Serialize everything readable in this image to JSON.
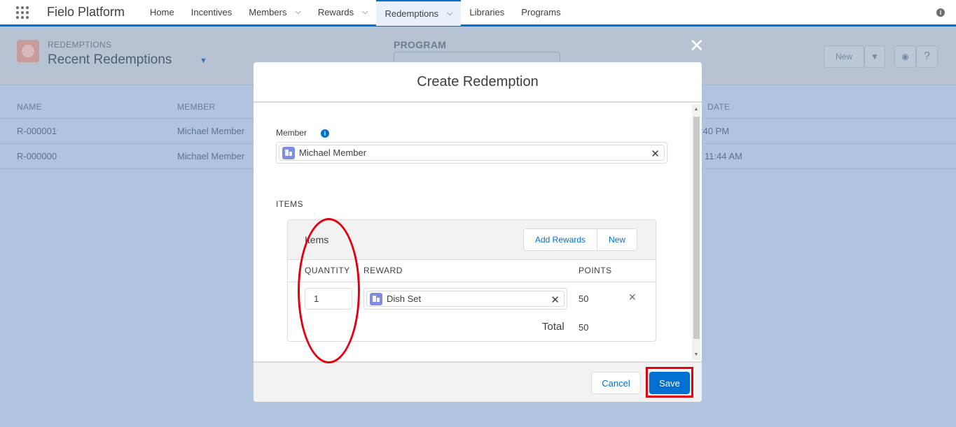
{
  "app": {
    "name": "Fielo Platform"
  },
  "nav": {
    "items": [
      {
        "label": "Home",
        "has_menu": false
      },
      {
        "label": "Incentives",
        "has_menu": false
      },
      {
        "label": "Members",
        "has_menu": true
      },
      {
        "label": "Rewards",
        "has_menu": true
      },
      {
        "label": "Redemptions",
        "has_menu": true,
        "active": true
      },
      {
        "label": "Libraries",
        "has_menu": false
      },
      {
        "label": "Programs",
        "has_menu": false
      }
    ]
  },
  "background": {
    "object_label": "REDEMPTIONS",
    "list_title": "Recent Redemptions",
    "program_label": "PROGRAM",
    "new_button": "New",
    "help_icon": "?",
    "columns": [
      "NAME",
      "MEMBER",
      "DATE"
    ],
    "rows": [
      {
        "name": "R-000001",
        "member": "Michael Member",
        "date": ":40 PM"
      },
      {
        "name": "R-000000",
        "member": "Michael Member",
        "date": "11:44 AM"
      }
    ]
  },
  "modal": {
    "title": "Create Redemption",
    "close_icon": "✕",
    "member_label": "Member",
    "member_value": "Michael Member",
    "items_section": "ITEMS",
    "items_card_title": "Items",
    "add_rewards": "Add Rewards",
    "new": "New",
    "columns": {
      "quantity": "QUANTITY",
      "reward": "REWARD",
      "points": "POINTS"
    },
    "row": {
      "quantity": "1",
      "reward": "Dish Set",
      "points": "50"
    },
    "total_label": "Total",
    "total_value": "50",
    "cancel": "Cancel",
    "save": "Save"
  },
  "colors": {
    "accent": "#0070d2",
    "annotation": "#e3000f"
  }
}
